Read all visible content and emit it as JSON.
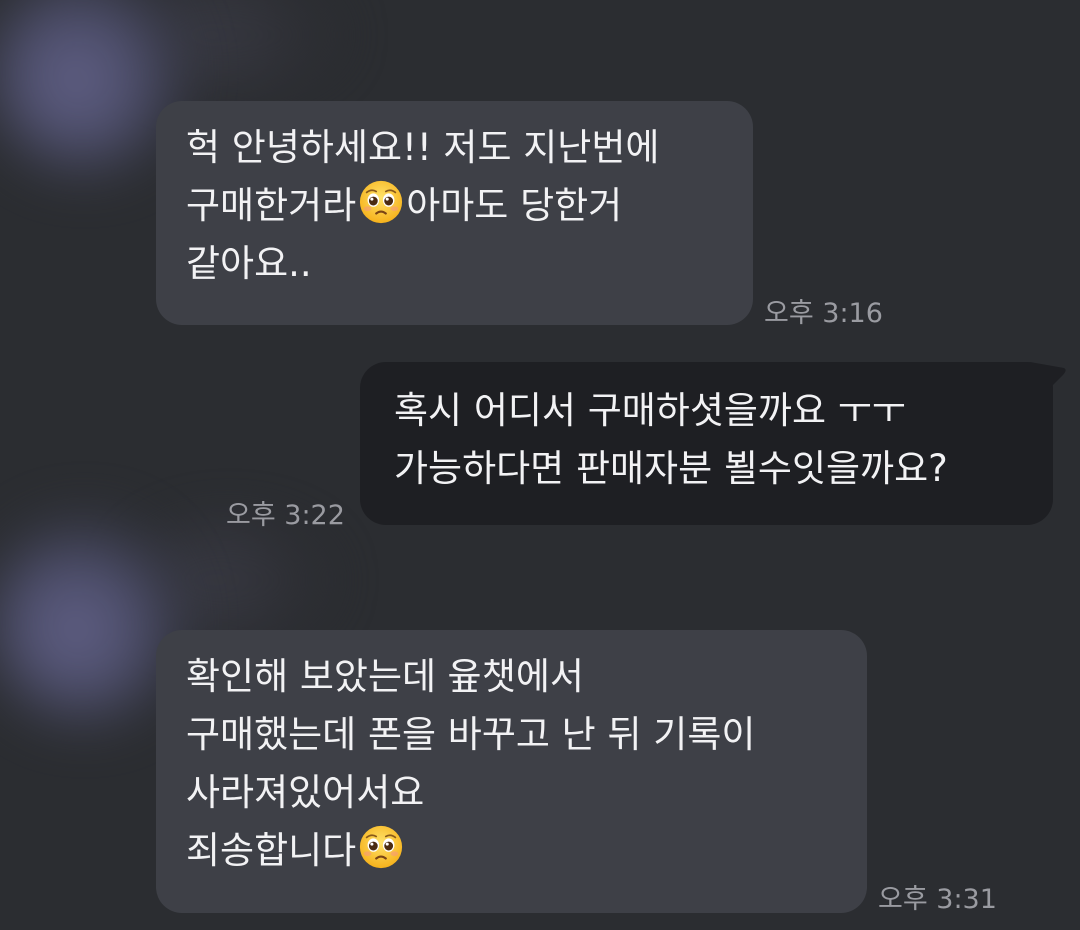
{
  "colors": {
    "background": "#2b2d31",
    "incoming_bubble": "#3e4047",
    "outgoing_bubble": "#1e1f23",
    "text": "#f2f2f4",
    "timestamp": "#9a9ba1"
  },
  "messages": [
    {
      "direction": "incoming",
      "lines": [
        "헉 안녕하세요!! 저도 지난번에",
        "구매한거라",
        "아마도 당한거",
        "같아요.."
      ],
      "emoji": "pleading-face-emoji",
      "time": "오후 3:16"
    },
    {
      "direction": "outgoing",
      "lines": [
        "혹시 어디서 구매하셧을까요 ㅜㅜ",
        "가능하다면 판매자분 뵐수잇을까요?"
      ],
      "time": "오후 3:22"
    },
    {
      "direction": "incoming",
      "lines": [
        "확인해 보았는데 윺챗에서",
        "구매했는데 폰을 바꾸고 난 뒤 기록이",
        "사라져있어서요",
        "죄송합니다"
      ],
      "emoji": "pleading-face-emoji",
      "time": "오후 3:31"
    }
  ]
}
